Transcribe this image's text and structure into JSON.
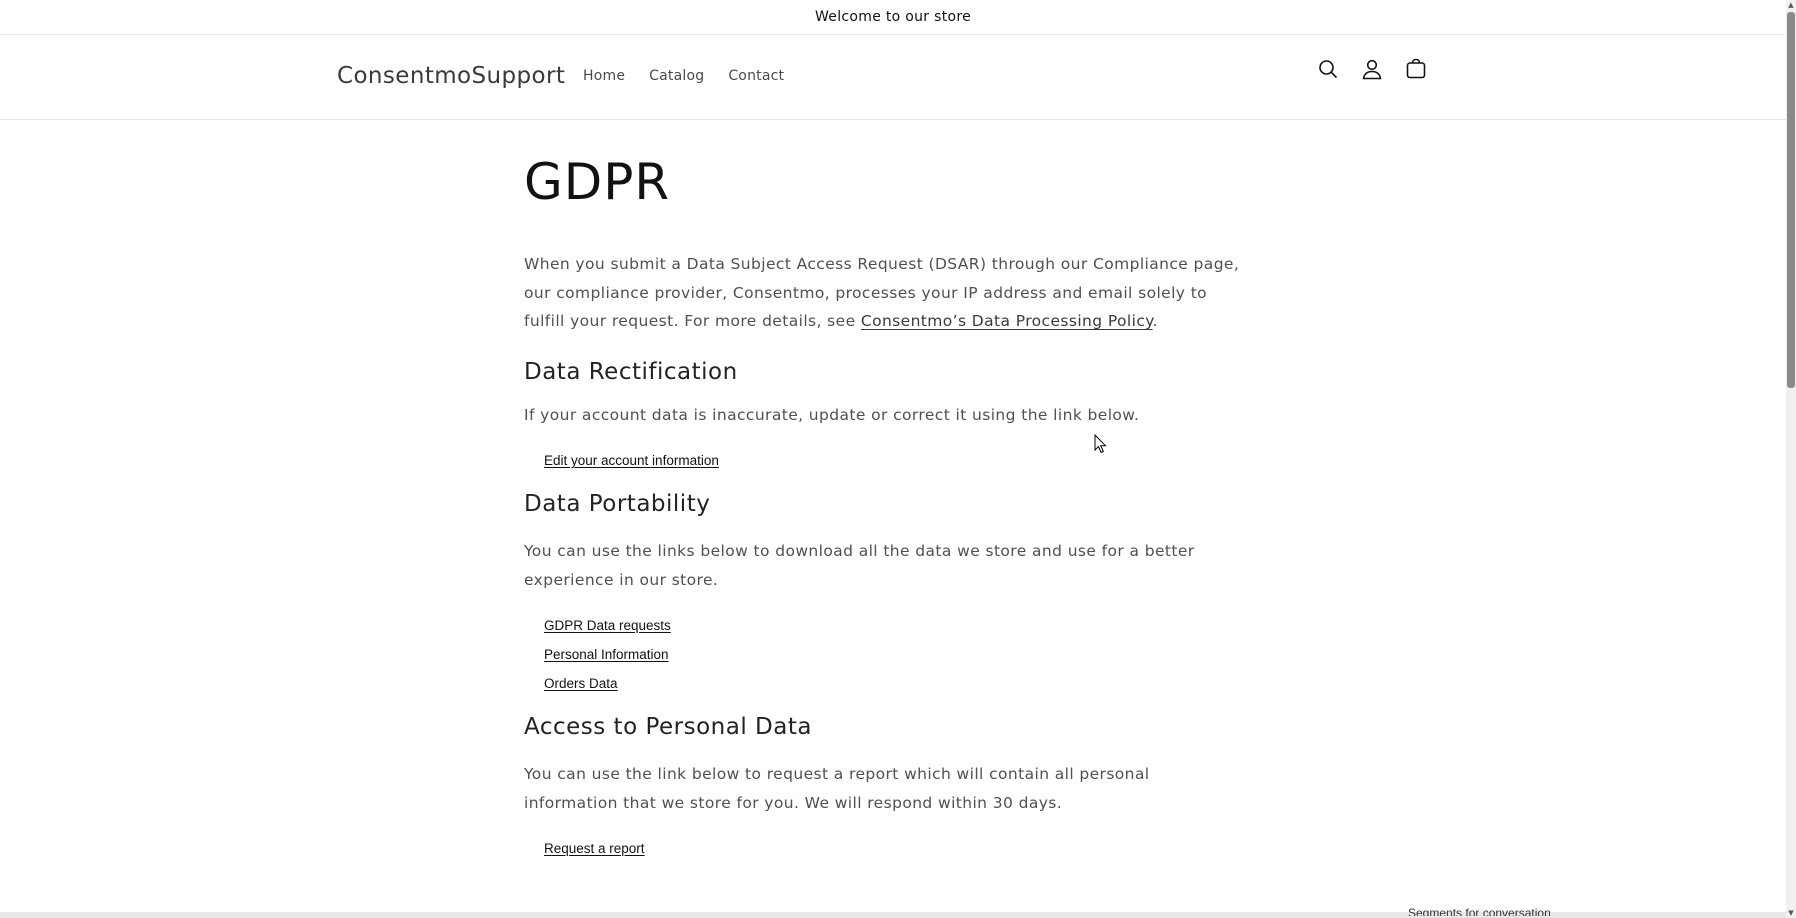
{
  "announcement": {
    "text": "Welcome to our store"
  },
  "header": {
    "logo": "ConsentmoSupport",
    "nav": [
      {
        "label": "Home"
      },
      {
        "label": "Catalog"
      },
      {
        "label": "Contact"
      }
    ],
    "icons": [
      "search-icon",
      "account-icon",
      "cart-icon"
    ]
  },
  "main": {
    "title": "GDPR",
    "intro": {
      "text": "When you submit a Data Subject Access Request (DSAR) through our Compliance page, our compliance provider, Consentmo, processes your IP address and email solely to fulfill your request. For more details, see ",
      "link": "Consentmo’s Data Processing Policy",
      "end": "."
    },
    "rectification": {
      "heading": "Data Rectification",
      "text": "If your account data is inaccurate, update or correct it using the link below.",
      "links": [
        {
          "label": "Edit your account information"
        }
      ]
    },
    "portability": {
      "heading": "Data Portability",
      "text": "You can use the links below to download all the data we store and use for a better experience in our store.",
      "links": [
        {
          "label": "GDPR Data requests"
        },
        {
          "label": "Personal Information"
        },
        {
          "label": "Orders Data"
        }
      ]
    },
    "access": {
      "heading": "Access to Personal Data",
      "text": "You can use the link below to request a report which will contain all personal information that we store for you. We will respond within 30 days.",
      "links": [
        {
          "label": "Request a report"
        }
      ]
    }
  },
  "bottom_snippet": "Segments for conversation"
}
